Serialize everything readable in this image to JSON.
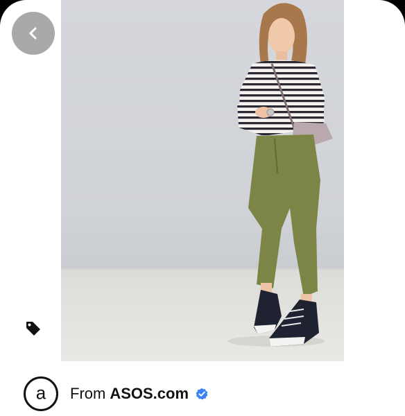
{
  "source": {
    "from_label": "From",
    "brand_name": "ASOS.com",
    "avatar_letter": "a"
  },
  "icons": {
    "back": "chevron-left-icon",
    "tag": "tag-icon",
    "verified": "verified-badge-icon"
  },
  "colors": {
    "back_button_bg": "#a9a9a9",
    "verified": "#3b82f6",
    "photo_backdrop": "#d5d7dc"
  }
}
